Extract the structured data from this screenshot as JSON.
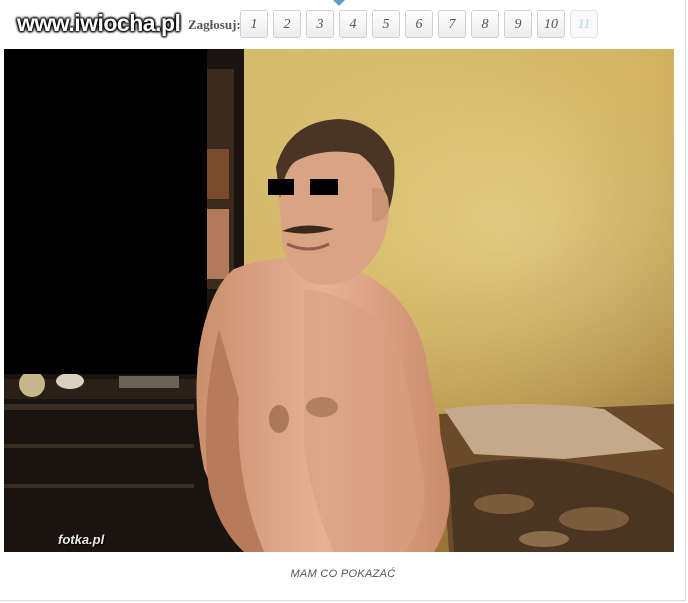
{
  "header": {
    "watermark": "www.iwiocha.pl",
    "vote_label": "Zagłosuj:",
    "vote_options": [
      "1",
      "2",
      "3",
      "4",
      "5",
      "6",
      "7",
      "8",
      "9",
      "10",
      "11"
    ],
    "vote_disabled": [
      "11"
    ]
  },
  "photo": {
    "credit": "fotka.pl"
  },
  "caption": "MAM CO POKAZAĆ"
}
